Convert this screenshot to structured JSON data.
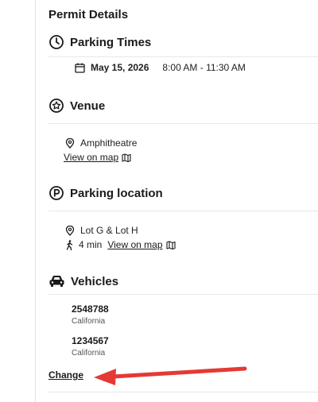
{
  "permit": {
    "title": "Permit Details",
    "parking_times": {
      "heading": "Parking Times",
      "date": "May 15, 2026",
      "time_range": "8:00 AM - 11:30 AM"
    },
    "venue": {
      "heading": "Venue",
      "name": "Amphitheatre",
      "map_link": "View on map"
    },
    "parking_location": {
      "heading": "Parking location",
      "lots": "Lot G & Lot H",
      "walk_time": "4 min",
      "map_link": "View on map"
    },
    "vehicles": {
      "heading": "Vehicles",
      "items": [
        {
          "plate": "2548788",
          "state": "California"
        },
        {
          "plate": "1234567",
          "state": "California"
        }
      ],
      "change_label": "Change"
    }
  },
  "colors": {
    "annotation_arrow": "#e53935",
    "divider": "#e8e8e8"
  }
}
